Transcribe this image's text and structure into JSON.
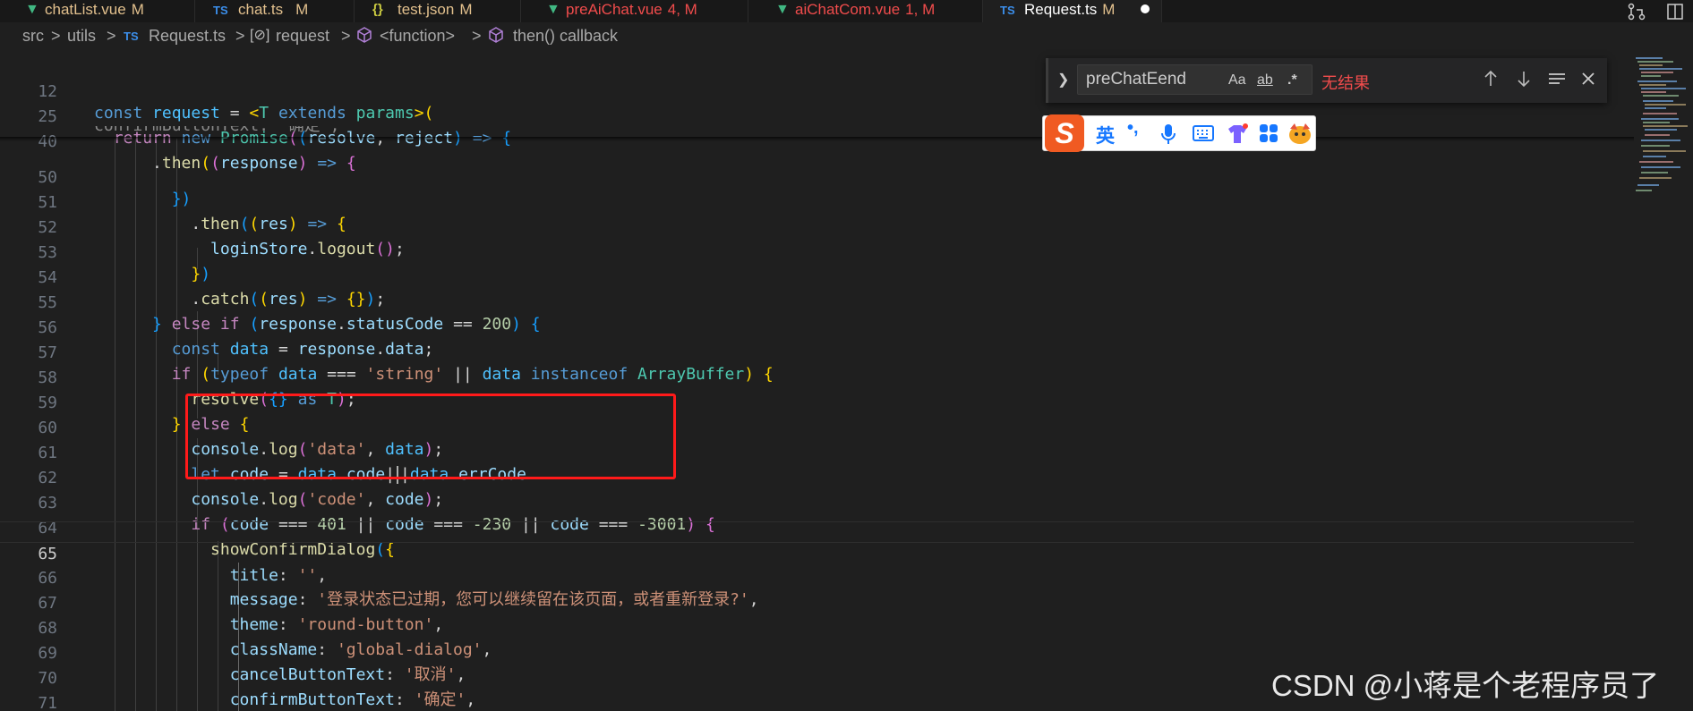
{
  "tabs": [
    {
      "name": "chatList.vue",
      "status": "M",
      "icon": "vue-icon"
    },
    {
      "name": "chat.ts",
      "status": "M",
      "icon": "ts-icon",
      "icon_text": "TS"
    },
    {
      "name": "test.json",
      "status": "M",
      "icon": "json-icon",
      "icon_text": "{}"
    },
    {
      "name": "preAiChat.vue",
      "status": "4, M",
      "icon": "vue-icon"
    },
    {
      "name": "aiChatCom.vue",
      "status": "1, M",
      "icon": "vue-icon"
    },
    {
      "name": "Request.ts",
      "status": "M",
      "icon": "ts-icon",
      "icon_text": "TS",
      "active": true,
      "dirty": true
    }
  ],
  "breadcrumb": {
    "items": [
      "src",
      "utils",
      "Request.ts",
      "request",
      "<function>",
      "then() callback"
    ],
    "separator": ">",
    "file_icon_text": "TS"
  },
  "find": {
    "value": "preChatEend",
    "result": "无结果",
    "options": [
      "Aa",
      "ab",
      ".*"
    ],
    "colors": {
      "result": "#f14c4c"
    }
  },
  "ime": {
    "logo": "S",
    "language": "英",
    "punct": "•,"
  },
  "editor": {
    "current_line": "65",
    "lines": [
      {
        "n": "12"
      },
      {
        "n": "25"
      },
      {
        "n": "40"
      },
      {
        "n": "50"
      },
      {
        "n": "51"
      },
      {
        "n": "52"
      },
      {
        "n": "53"
      },
      {
        "n": "54"
      },
      {
        "n": "55"
      },
      {
        "n": "56"
      },
      {
        "n": "57"
      },
      {
        "n": "58"
      },
      {
        "n": "59"
      },
      {
        "n": "60"
      },
      {
        "n": "61"
      },
      {
        "n": "62"
      },
      {
        "n": "63"
      },
      {
        "n": "64"
      },
      {
        "n": "65"
      },
      {
        "n": "66"
      },
      {
        "n": "67"
      },
      {
        "n": "68"
      },
      {
        "n": "69"
      },
      {
        "n": "70"
      },
      {
        "n": "71"
      }
    ],
    "strings": {
      "string": "'string'",
      "data": "'data'",
      "code": "'code'",
      "empty": "''",
      "message": "'登录状态已过期，您可以继续留在该页面，或者重新登录?'",
      "theme": "'round-button'",
      "className": "'global-dialog'",
      "cancel": "'取消'",
      "confirm": "'确定'",
      "hidden_line": "confirmButtonText: '确定',"
    },
    "numbers": {
      "n200": "200",
      "n401": "401",
      "n230": "-230",
      "n3001": "-3001"
    }
  },
  "watermark": "CSDN @小蒋是个老程序员了",
  "colors": {
    "accent": "#3b8eea",
    "highlight_box": "#ff1a1a",
    "vue": "#41b883"
  }
}
